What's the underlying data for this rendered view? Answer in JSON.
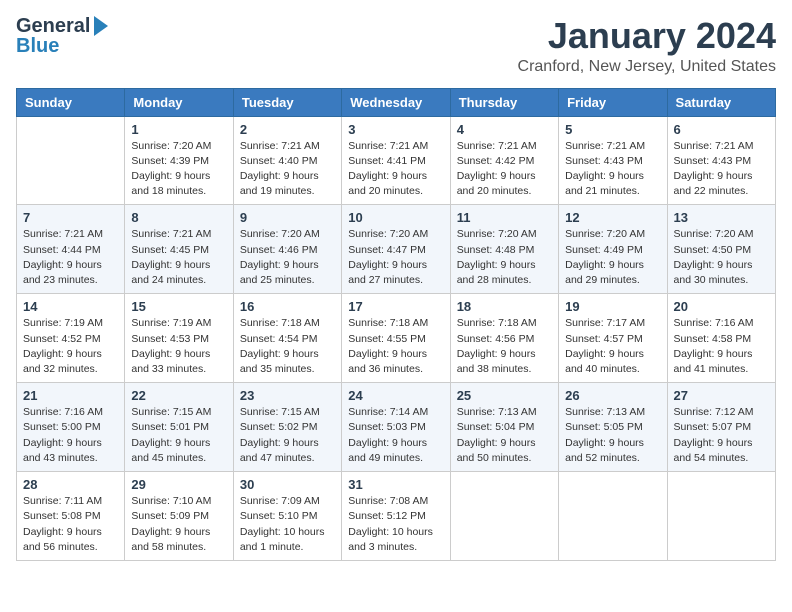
{
  "header": {
    "logo_general": "General",
    "logo_blue": "Blue",
    "month_year": "January 2024",
    "location": "Cranford, New Jersey, United States"
  },
  "days_of_week": [
    "Sunday",
    "Monday",
    "Tuesday",
    "Wednesday",
    "Thursday",
    "Friday",
    "Saturday"
  ],
  "weeks": [
    [
      {
        "day": "",
        "info": ""
      },
      {
        "day": "1",
        "info": "Sunrise: 7:20 AM\nSunset: 4:39 PM\nDaylight: 9 hours\nand 18 minutes."
      },
      {
        "day": "2",
        "info": "Sunrise: 7:21 AM\nSunset: 4:40 PM\nDaylight: 9 hours\nand 19 minutes."
      },
      {
        "day": "3",
        "info": "Sunrise: 7:21 AM\nSunset: 4:41 PM\nDaylight: 9 hours\nand 20 minutes."
      },
      {
        "day": "4",
        "info": "Sunrise: 7:21 AM\nSunset: 4:42 PM\nDaylight: 9 hours\nand 20 minutes."
      },
      {
        "day": "5",
        "info": "Sunrise: 7:21 AM\nSunset: 4:43 PM\nDaylight: 9 hours\nand 21 minutes."
      },
      {
        "day": "6",
        "info": "Sunrise: 7:21 AM\nSunset: 4:43 PM\nDaylight: 9 hours\nand 22 minutes."
      }
    ],
    [
      {
        "day": "7",
        "info": "Sunrise: 7:21 AM\nSunset: 4:44 PM\nDaylight: 9 hours\nand 23 minutes."
      },
      {
        "day": "8",
        "info": "Sunrise: 7:21 AM\nSunset: 4:45 PM\nDaylight: 9 hours\nand 24 minutes."
      },
      {
        "day": "9",
        "info": "Sunrise: 7:20 AM\nSunset: 4:46 PM\nDaylight: 9 hours\nand 25 minutes."
      },
      {
        "day": "10",
        "info": "Sunrise: 7:20 AM\nSunset: 4:47 PM\nDaylight: 9 hours\nand 27 minutes."
      },
      {
        "day": "11",
        "info": "Sunrise: 7:20 AM\nSunset: 4:48 PM\nDaylight: 9 hours\nand 28 minutes."
      },
      {
        "day": "12",
        "info": "Sunrise: 7:20 AM\nSunset: 4:49 PM\nDaylight: 9 hours\nand 29 minutes."
      },
      {
        "day": "13",
        "info": "Sunrise: 7:20 AM\nSunset: 4:50 PM\nDaylight: 9 hours\nand 30 minutes."
      }
    ],
    [
      {
        "day": "14",
        "info": "Sunrise: 7:19 AM\nSunset: 4:52 PM\nDaylight: 9 hours\nand 32 minutes."
      },
      {
        "day": "15",
        "info": "Sunrise: 7:19 AM\nSunset: 4:53 PM\nDaylight: 9 hours\nand 33 minutes."
      },
      {
        "day": "16",
        "info": "Sunrise: 7:18 AM\nSunset: 4:54 PM\nDaylight: 9 hours\nand 35 minutes."
      },
      {
        "day": "17",
        "info": "Sunrise: 7:18 AM\nSunset: 4:55 PM\nDaylight: 9 hours\nand 36 minutes."
      },
      {
        "day": "18",
        "info": "Sunrise: 7:18 AM\nSunset: 4:56 PM\nDaylight: 9 hours\nand 38 minutes."
      },
      {
        "day": "19",
        "info": "Sunrise: 7:17 AM\nSunset: 4:57 PM\nDaylight: 9 hours\nand 40 minutes."
      },
      {
        "day": "20",
        "info": "Sunrise: 7:16 AM\nSunset: 4:58 PM\nDaylight: 9 hours\nand 41 minutes."
      }
    ],
    [
      {
        "day": "21",
        "info": "Sunrise: 7:16 AM\nSunset: 5:00 PM\nDaylight: 9 hours\nand 43 minutes."
      },
      {
        "day": "22",
        "info": "Sunrise: 7:15 AM\nSunset: 5:01 PM\nDaylight: 9 hours\nand 45 minutes."
      },
      {
        "day": "23",
        "info": "Sunrise: 7:15 AM\nSunset: 5:02 PM\nDaylight: 9 hours\nand 47 minutes."
      },
      {
        "day": "24",
        "info": "Sunrise: 7:14 AM\nSunset: 5:03 PM\nDaylight: 9 hours\nand 49 minutes."
      },
      {
        "day": "25",
        "info": "Sunrise: 7:13 AM\nSunset: 5:04 PM\nDaylight: 9 hours\nand 50 minutes."
      },
      {
        "day": "26",
        "info": "Sunrise: 7:13 AM\nSunset: 5:05 PM\nDaylight: 9 hours\nand 52 minutes."
      },
      {
        "day": "27",
        "info": "Sunrise: 7:12 AM\nSunset: 5:07 PM\nDaylight: 9 hours\nand 54 minutes."
      }
    ],
    [
      {
        "day": "28",
        "info": "Sunrise: 7:11 AM\nSunset: 5:08 PM\nDaylight: 9 hours\nand 56 minutes."
      },
      {
        "day": "29",
        "info": "Sunrise: 7:10 AM\nSunset: 5:09 PM\nDaylight: 9 hours\nand 58 minutes."
      },
      {
        "day": "30",
        "info": "Sunrise: 7:09 AM\nSunset: 5:10 PM\nDaylight: 10 hours\nand 1 minute."
      },
      {
        "day": "31",
        "info": "Sunrise: 7:08 AM\nSunset: 5:12 PM\nDaylight: 10 hours\nand 3 minutes."
      },
      {
        "day": "",
        "info": ""
      },
      {
        "day": "",
        "info": ""
      },
      {
        "day": "",
        "info": ""
      }
    ]
  ]
}
